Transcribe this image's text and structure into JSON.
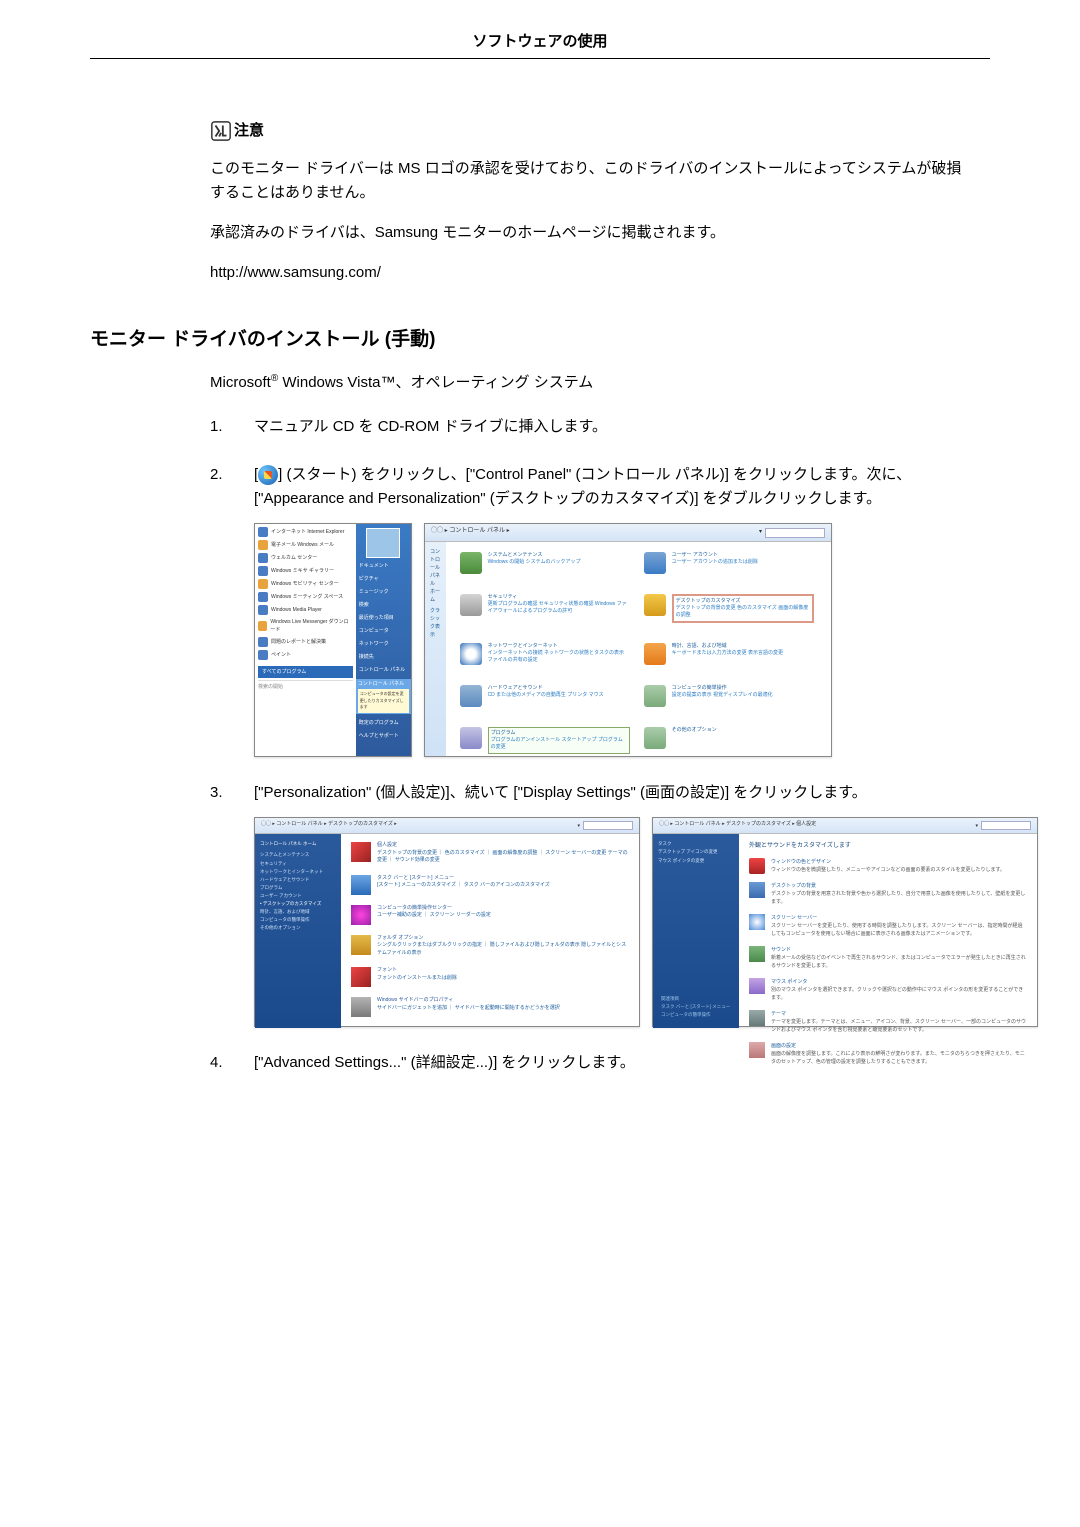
{
  "header": {
    "title": "ソフトウェアの使用"
  },
  "note": {
    "label": "注意",
    "line1": "このモニター ドライバーは MS ロゴの承認を受けており、このドライバのインストールによってシステムが破損することはありません。",
    "line2": "承認済みのドライバは、Samsung モニターのホームページに掲載されます。",
    "url": "http://www.samsung.com/"
  },
  "section": {
    "title": "モニター ドライバのインストール (手動)",
    "system_prefix": "Microsoft",
    "system_suffix": " Windows Vista™、オペレーティング システム"
  },
  "steps": {
    "n1": "1.",
    "s1": "マニュアル CD を CD-ROM ドライブに挿入します。",
    "n2": "2.",
    "s2_pre": "[",
    "s2_post": "] (スタート) をクリックし、[\"Control Panel\" (コントロール パネル)] をクリックします。次に、[\"Appearance and Personalization\" (デスクトップのカスタマイズ)] をダブルクリックします。",
    "n3": "3.",
    "s3": "[\"Personalization\" (個人設定)]、続いて [\"Display Settings\" (画面の設定)] をクリックします。",
    "n4": "4.",
    "s4": "[\"Advanced Settings...\" (詳細設定...)] をクリックします。"
  },
  "shotA": {
    "items": [
      "インターネット\nInternet Explorer",
      "電子メール\nWindows メール",
      "ウェルカム センター",
      "Windows ミキサ ギャラリー",
      "Windows モビリティ センター",
      "Windows ミーティング スペース",
      "Windows Media Player",
      "Windows Live Messenger ダウンロード",
      "問題のレポートと解決策",
      "ペイント"
    ],
    "all": "すべてのプログラム",
    "search": "検索の開始",
    "menu": [
      "ドキュメント",
      "ピクチャ",
      "ミュージック",
      "検索",
      "最近使った項目",
      "コンピュータ",
      "ネットワーク",
      "接続先",
      "コントロール パネル",
      "",
      "既定のプログラム",
      "ヘルプとサポート"
    ],
    "menu_sub": "コンピュータの設定を変更したりカスタマイズします"
  },
  "shotB": {
    "crumb": "▸ コントロール パネル ▸",
    "sidetitle": "コントロール パネル ホーム",
    "sidelink": "クラシック表示",
    "search": "検索",
    "cells": [
      {
        "t": "システムとメンテナンス",
        "s": "Windows の開始\nシステムのバックアップ"
      },
      {
        "t": "ユーザー アカウント",
        "s": "ユーザー アカウントの追加または削除"
      },
      {
        "t": "セキュリティ",
        "s": "更新プログラムの確認\nセキュリティ状態の確認\nWindows ファイアウォールによるプログラムの許可"
      },
      {
        "t": "デスクトップのカスタマイズ",
        "s": "デスクトップの背景の変更\n色のカスタマイズ\n画面の解像度の調整"
      },
      {
        "t": "ネットワークとインターネット",
        "s": "インターネットへの接続\nネットワークの状態とタスクの表示\nファイルの共有の設定"
      },
      {
        "t": "時計、言語、および地域",
        "s": "キーボードまたは入力方法の変更\n表示言語の変更"
      },
      {
        "t": "ハードウェアとサウンド",
        "s": "CD または他のメディアの自動再生\nプリンタ\nマウス"
      },
      {
        "t": "コンピュータの簡単操作",
        "s": "設定の提案の表示\n視覚ディスプレイの最適化"
      },
      {
        "t": "プログラム",
        "s": "プログラムのアンインストール\nスタートアップ プログラムの変更"
      },
      {
        "t": "その他のオプション",
        "s": ""
      }
    ]
  },
  "shotC": {
    "crumb": "▸ コントロール パネル ▸ デスクトップのカスタマイズ ▸",
    "search": "検索",
    "side_head": "コントロール パネル ホーム",
    "side": [
      "システムとメンテナンス",
      "セキュリティ",
      "ネットワークとインターネット",
      "ハードウェアとサウンド",
      "プログラム",
      "ユーザー アカウント",
      "デスクトップのカスタマイズ",
      "時計、言語、および地域",
      "コンピュータの簡単操作",
      "その他のオプション"
    ],
    "cells": [
      {
        "t": "個人設定",
        "s": "デスクトップの背景の変更 ｜ 色のカスタマイズ ｜ 画面の解像度の調整 ｜ スクリーン セーバーの変更\nテーマの変更 ｜ サウンド効果の変更"
      },
      {
        "t": "タスク バーと [スタート] メニュー",
        "s": "[スタート] メニューのカスタマイズ ｜ タスク バーのアイコンのカスタマイズ"
      },
      {
        "t": "コンピュータの簡単操作センター",
        "s": "ユーザー補助の設定 ｜ スクリーン リーダーの設定"
      },
      {
        "t": "フォルダ オプション",
        "s": "シングルクリックまたはダブルクリックの指定 ｜ 隠しファイルおよび隠しフォルダの表示\n隠しファイルとシステムファイルの表示"
      },
      {
        "t": "フォント",
        "s": "フォントのインストールまたは削除"
      },
      {
        "t": "Windows サイドバーのプロパティ",
        "s": "サイドバーにガジェットを追加 ｜ サイドバーを起動時に開始するかどうかを選択"
      }
    ]
  },
  "shotD": {
    "crumb": "▸ コントロール パネル ▸ デスクトップのカスタマイズ ▸ 個人設定",
    "search": "検索",
    "side": [
      "タスク",
      "デスクトップ アイコンの変更",
      "マウス ポインタの変更"
    ],
    "side_bot": [
      "関連項目",
      "タスク バーと [スタート] メニュー",
      "コンピュータの簡単操作"
    ],
    "title": "外観とサウンドをカスタマイズします",
    "cells": [
      {
        "t": "ウィンドウの色とデザイン",
        "s": "ウィンドウの色を微調整したり、メニューやアイコンなどの画面の要素のスタイルを変更したりします。"
      },
      {
        "t": "デスクトップの背景",
        "s": "デスクトップの背景を用意された背景や色から選択したり、自分で用意した画像を使用したりして、壁紙を変更します。"
      },
      {
        "t": "スクリーン セーバー",
        "s": "スクリーン セーバーを変更したり、使用する時間を調整したりします。スクリーン セーバーは、指定時間が経過してもコンピュータを使用しない場合に画面に表示される画像またはアニメーションです。"
      },
      {
        "t": "サウンド",
        "s": "新着メールの受信などのイベントで再生されるサウンド、またはコンピュータでエラーが発生したときに再生されるサウンドを変更します。"
      },
      {
        "t": "マウス ポインタ",
        "s": "別のマウス ポインタを選択できます。クリックや選択などの動作中にマウス ポインタの形を変更することができます。"
      },
      {
        "t": "テーマ",
        "s": "テーマを変更します。テーマとは、メニュー、アイコン、背景、スクリーン セーバー、一部のコンピュータのサウンドおよびマウス ポインタを含む視覚要素と聴覚要素のセットです。"
      },
      {
        "t": "画面の設定",
        "s": "画面の解像度を調整します。これにより表示の鮮明さが変わります。また、モニタのちらつきを押さえたり、モニタのセットアップ、色の管理の設定を調整したりすることもできます。"
      }
    ]
  }
}
